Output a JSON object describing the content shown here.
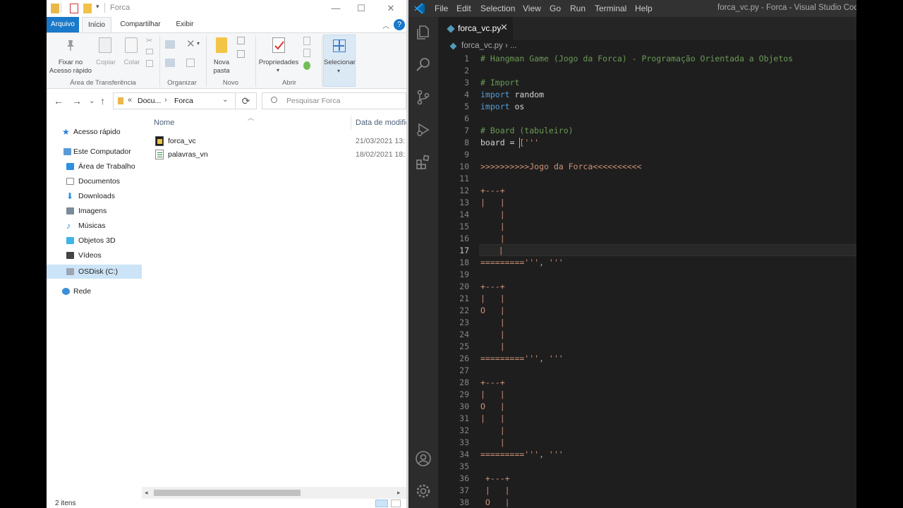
{
  "explorer": {
    "window_title": "Forca",
    "window_buttons": {
      "minimize": "—",
      "maximize": "☐",
      "close": "✕"
    },
    "tabs": {
      "file": "Arquivo",
      "home": "Início",
      "share": "Compartilhar",
      "view": "Exibir"
    },
    "help": "?",
    "ribbon": {
      "pin": "Fixar no\nAcesso rápido",
      "copy": "Copiar",
      "paste": "Colar",
      "group_clipboard": "Área de Transferência",
      "group_organize": "Organizar",
      "new_folder": "Nova\npasta",
      "group_new": "Novo",
      "properties": "Propriedades",
      "group_open": "Abrir",
      "select": "Selecionar"
    },
    "address": {
      "prefix": "«",
      "crumb1": "Docu...",
      "sep": "›",
      "crumb2": "Forca"
    },
    "search_placeholder": "Pesquisar Forca",
    "nav": {
      "quick_access": "Acesso rápido",
      "this_pc": "Este Computador",
      "desktop": "Área de Trabalho",
      "documents": "Documentos",
      "downloads": "Downloads",
      "pictures": "Imagens",
      "music": "Músicas",
      "objects3d": "Objetos 3D",
      "videos": "Vídeos",
      "osdisk": "OSDisk (C:)",
      "network": "Rede"
    },
    "columns": {
      "name": "Nome",
      "date": "Data de modific"
    },
    "files": [
      {
        "name": "forca_vc",
        "date": "21/03/2021 13:"
      },
      {
        "name": "palavras_vn",
        "date": "18/02/2021 18:"
      }
    ],
    "status": "2 itens"
  },
  "vscode": {
    "menu": [
      "File",
      "Edit",
      "Selection",
      "View",
      "Go",
      "Run",
      "Terminal",
      "Help"
    ],
    "title": "forca_vc.py - Forca - Visual Studio Code",
    "tab_label": "forca_vc.py",
    "tab_close": "✕",
    "breadcrumb": "forca_vc.py › ...",
    "line_numbers": [
      "1",
      "2",
      "3",
      "4",
      "5",
      "6",
      "7",
      "8",
      "9",
      "10",
      "11",
      "12",
      "13",
      "14",
      "15",
      "16",
      "17",
      "18",
      "19",
      "20",
      "21",
      "22",
      "23",
      "24",
      "25",
      "26",
      "27",
      "28",
      "29",
      "30",
      "31",
      "32",
      "33",
      "34",
      "35",
      "36",
      "37",
      "38"
    ],
    "lines": {
      "l1": "# Hangman Game (Jogo da Forca) - Programação Orientada a Objetos",
      "l3": "# Import",
      "l4_kw": "import",
      "l4_rest": " random",
      "l5_kw": "import",
      "l5_rest": " os",
      "l7": "# Board (tabuleiro)",
      "l8_a": "board = ",
      "l8_b": "['''",
      "l10": ">>>>>>>>>>Jogo da Forca<<<<<<<<<<",
      "l12": "+---+",
      "l13": "|   |",
      "l14": "    |",
      "l15": "    |",
      "l16": "    |",
      "l17": "    |",
      "l18": "=========''', '''",
      "l20": "+---+",
      "l21": "|   |",
      "l22": "O   |",
      "l23": "    |",
      "l24": "    |",
      "l25": "    |",
      "l26": "=========''', '''",
      "l28": "+---+",
      "l29": "|   |",
      "l30": "O   |",
      "l31": "|   |",
      "l32": "    |",
      "l33": "    |",
      "l34": "=========''', '''",
      "l36": " +---+",
      "l37": " |   |",
      "l38": " O   |"
    }
  }
}
